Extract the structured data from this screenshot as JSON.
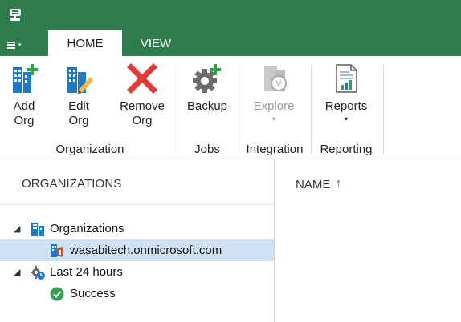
{
  "app": {
    "icon": "veeam-server-icon",
    "accent": "#2f7d4f"
  },
  "menu": {
    "label": "≡",
    "caret": "▾"
  },
  "tabs": [
    {
      "label": "HOME",
      "active": true
    },
    {
      "label": "VIEW",
      "active": false
    }
  ],
  "ribbon": {
    "groups": [
      {
        "label": "Organization",
        "buttons": [
          {
            "line1": "Add",
            "line2": "Org",
            "icon": "add-org-icon"
          },
          {
            "line1": "Edit",
            "line2": "Org",
            "icon": "edit-org-icon"
          },
          {
            "line1": "Remove",
            "line2": "Org",
            "icon": "remove-org-icon"
          }
        ]
      },
      {
        "label": "Jobs",
        "buttons": [
          {
            "line1": "Backup",
            "icon": "backup-icon"
          }
        ]
      },
      {
        "label": "Integration",
        "buttons": [
          {
            "line1": "Explore",
            "icon": "explore-icon",
            "disabled": true,
            "dropdown": "▾"
          }
        ]
      },
      {
        "label": "Reporting",
        "buttons": [
          {
            "line1": "Reports",
            "icon": "reports-icon",
            "dropdown": "▾"
          }
        ]
      }
    ]
  },
  "left_pane": {
    "title": "ORGANIZATIONS",
    "tree": [
      {
        "label": "Organizations",
        "expander": "◢",
        "icon": "organizations-icon",
        "level": 0
      },
      {
        "label": "wasabitech.onmicrosoft.com",
        "icon": "office365-org-icon",
        "level": 1,
        "selected": true
      },
      {
        "label": "Last 24 hours",
        "expander": "◢",
        "icon": "last-24-hours-icon",
        "level": 0
      },
      {
        "label": "Success",
        "icon": "success-icon",
        "level": 1
      }
    ]
  },
  "right_pane": {
    "column": "NAME",
    "sort": "↑"
  }
}
